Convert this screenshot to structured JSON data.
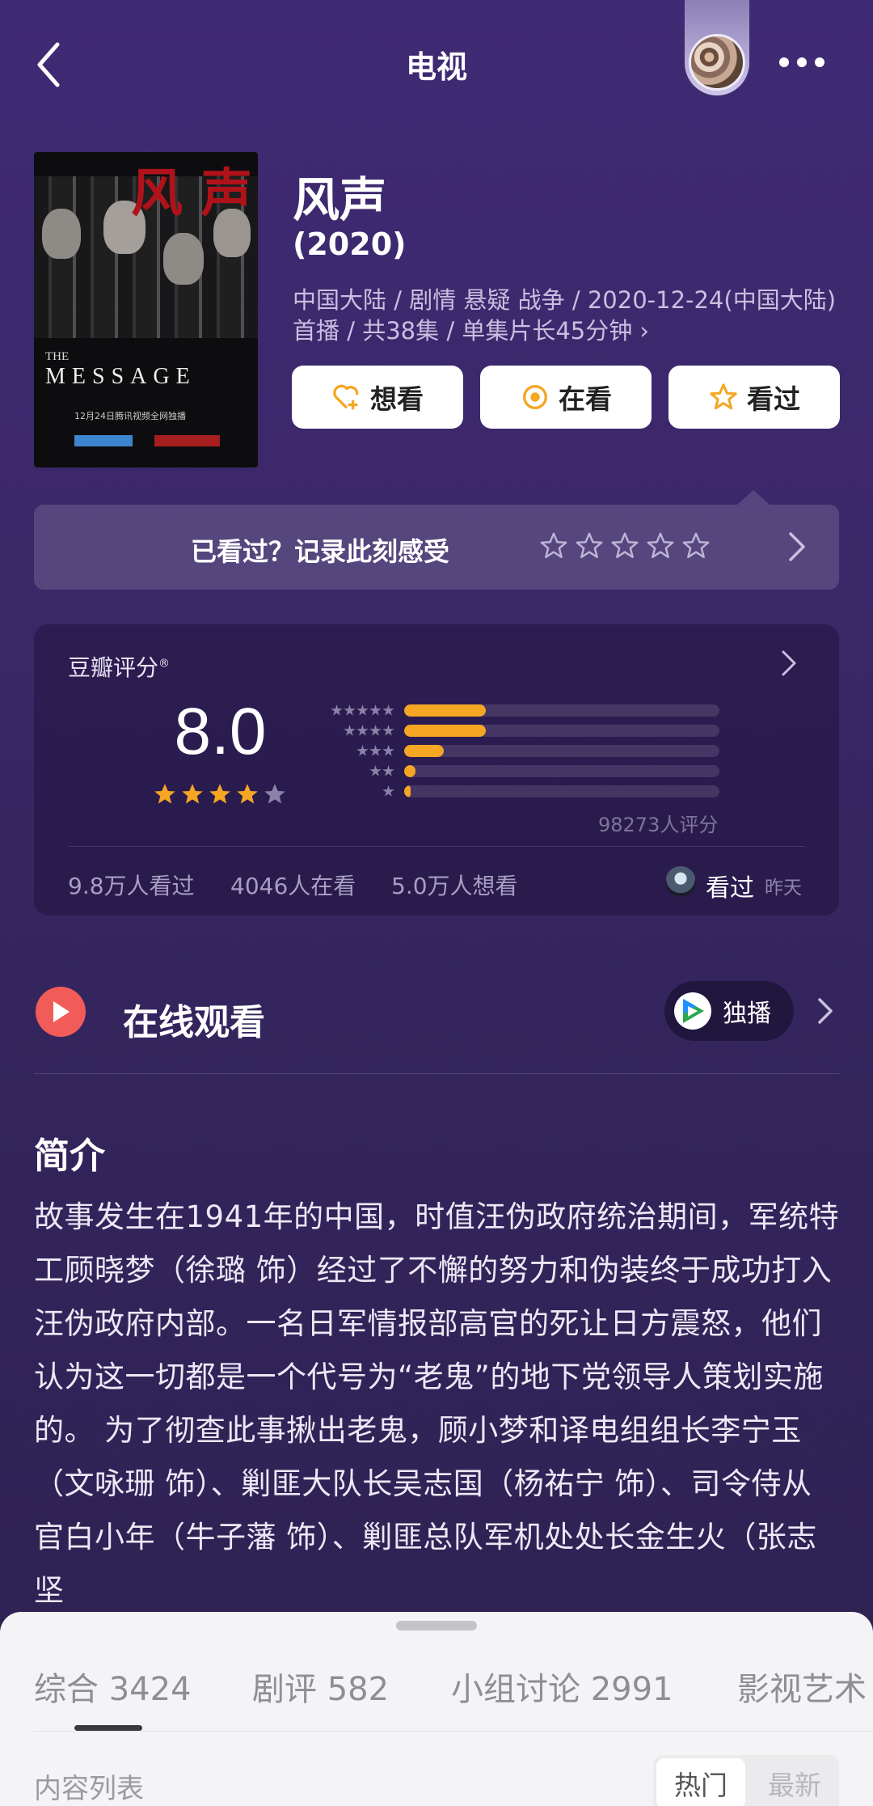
{
  "header": {
    "title": "电视",
    "back_icon": "chevron-left-icon",
    "more_icon": "more-dots-icon"
  },
  "movie": {
    "name": "风声",
    "year": "(2020)",
    "meta": "中国大陆 / 剧情 悬疑 战争 / 2020-12-24(中国大陆)首播 / 共38集 / 单集片长45分钟 ›",
    "poster": {
      "title_cn": "风 声",
      "title_en_small": "THE",
      "title_en": "MESSAGE",
      "tagline": "12月24日腾讯视频全网独播"
    }
  },
  "actions": [
    {
      "label": "想看",
      "icon": "heart-plus-icon"
    },
    {
      "label": "在看",
      "icon": "target-icon"
    },
    {
      "label": "看过",
      "icon": "star-icon"
    }
  ],
  "record": {
    "text": "已看过？记录此刻感受",
    "star_count": 5
  },
  "rating": {
    "label": "豆瓣评分",
    "score": "8.0",
    "stars_filled": 4,
    "distribution": [
      {
        "stars": 5,
        "fraction": 0.26
      },
      {
        "stars": 4,
        "fraction": 0.26
      },
      {
        "stars": 3,
        "fraction": 0.125
      },
      {
        "stars": 2,
        "fraction": 0.035
      },
      {
        "stars": 1,
        "fraction": 0.02
      }
    ],
    "count_text": "98273人评分",
    "stats": [
      "9.8万人看过",
      "4046人在看",
      "5.0万人想看"
    ],
    "friend": {
      "label": "看过",
      "time": "昨天"
    }
  },
  "online": {
    "title": "在线观看",
    "badge": "独播",
    "accent": "#f25c58"
  },
  "synopsis": {
    "title": "简介",
    "text": "故事发生在1941年的中国，时值汪伪政府统治期间，军统特工顾晓梦（徐璐 饰）经过了不懈的努力和伪装终于成功打入汪伪政府内部。一名日军情报部高官的死让日方震怒，他们认为这一切都是一个代号为“老鬼”的地下党领导人策划实施的。 为了彻查此事揪出老鬼，顾小梦和译电组组长李宁玉（文咏珊 饰）、剿匪大队长吴志国（杨祐宁 饰）、司令侍从官白小年（牛子藩 饰）、剿匪总队军机处处长金生火（张志坚"
  },
  "bottom_sheet": {
    "tabs": [
      {
        "label": "综合",
        "count": "3424"
      },
      {
        "label": "剧评",
        "count": "582"
      },
      {
        "label": "小组讨论",
        "count": "2991"
      },
      {
        "label": "影视艺术",
        "count": ""
      }
    ],
    "list_label": "内容列表",
    "sort_options": [
      "热门",
      "最新"
    ]
  },
  "colors": {
    "background": "#3b2869",
    "star": "#f5a623",
    "button_bg": "#ffffff"
  }
}
